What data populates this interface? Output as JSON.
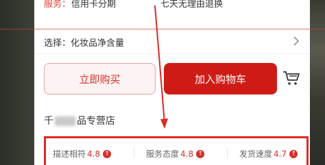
{
  "service": {
    "label": "服务：",
    "items": [
      "信用卡分期",
      "七天无理由退换"
    ]
  },
  "selection": {
    "text": "选择：化妆品净含量"
  },
  "actions": {
    "buy_now": "立即购买",
    "add_to_cart": "加入购物车"
  },
  "shop": {
    "name_prefix": "千",
    "name_suffix": "品专营店"
  },
  "ratings": [
    {
      "label": "描述相符",
      "score": "4.8"
    },
    {
      "label": "服务态度",
      "score": "4.8"
    },
    {
      "label": "发货速度",
      "score": "4.7"
    }
  ],
  "colors": {
    "accent": "#cf1b16",
    "annotation": "#d92a25"
  },
  "icons": {
    "up_arrow": "↑",
    "cart": "cart-icon",
    "chevron": "chevron-right-icon"
  }
}
